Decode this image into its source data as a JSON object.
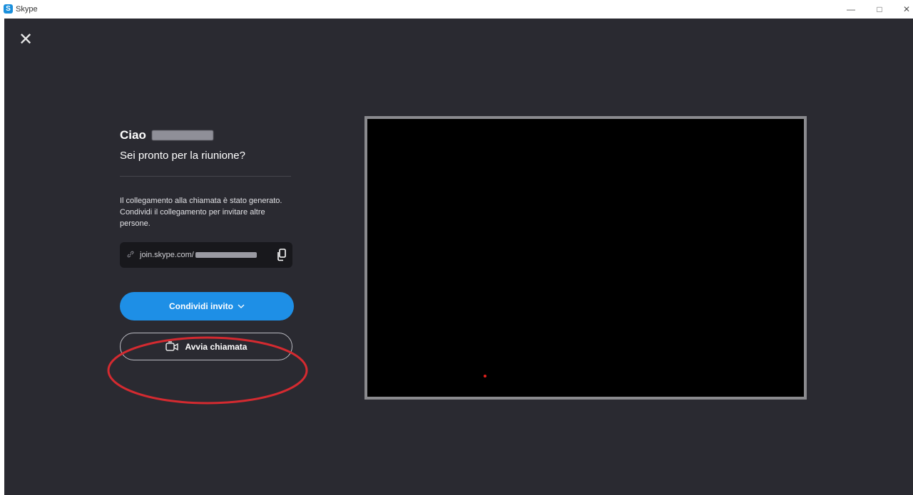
{
  "window": {
    "title": "Skype",
    "logo_letter": "S",
    "controls": {
      "minimize": "—",
      "maximize": "□",
      "close": "✕"
    }
  },
  "dialog": {
    "close_glyph": "✕",
    "greeting": "Ciao",
    "subtitle": "Sei pronto per la riunione?",
    "info_line1": "Il collegamento alla chiamata è stato generato.",
    "info_line2": "Condividi il collegamento per invitare altre persone.",
    "link_prefix": "join.skype.com/",
    "share_button": "Condividi invito",
    "start_button": "Avvia chiamata"
  },
  "icons": {
    "close": "close-icon",
    "link": "link-icon",
    "copy": "copy-icon",
    "chevron": "chevron-down-icon",
    "camera": "video-camera-icon"
  },
  "colors": {
    "background": "#2a2a31",
    "primary": "#1e8fe6",
    "annotation": "#d42a30",
    "preview": "#000000"
  }
}
